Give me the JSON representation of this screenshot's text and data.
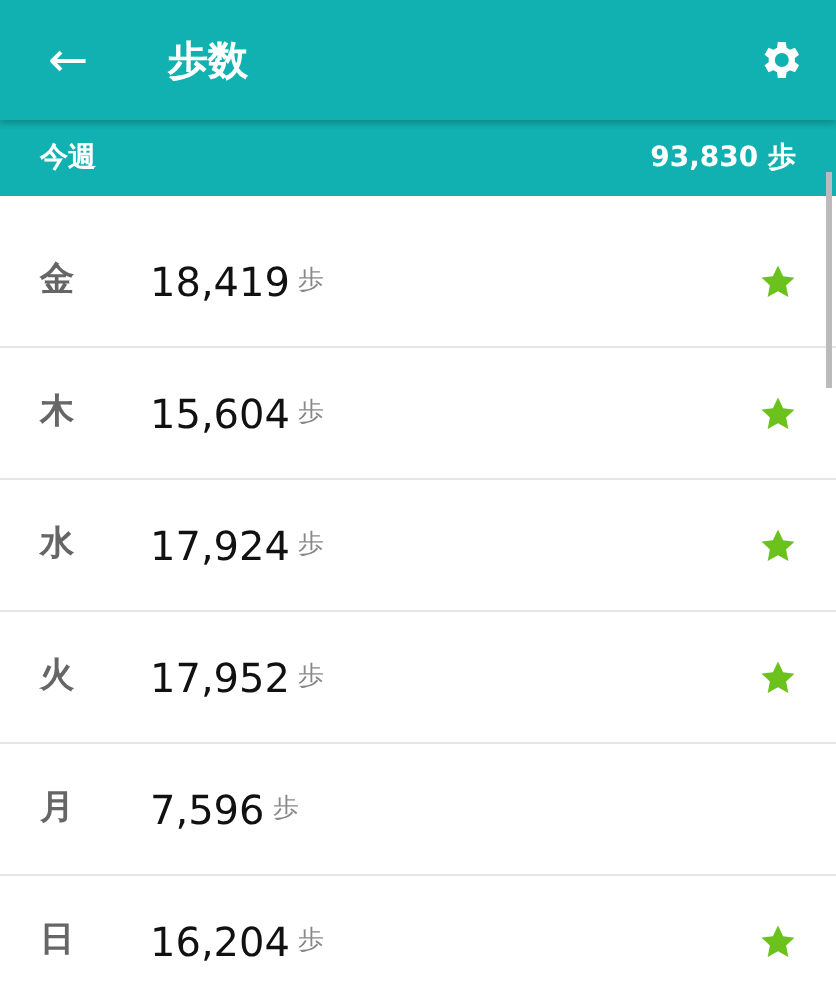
{
  "app_bar": {
    "back": "←",
    "title": "歩数"
  },
  "summary": {
    "label": "今週",
    "value": "93,830",
    "unit": "歩"
  },
  "days": [
    {
      "day": "金",
      "steps": "18,419",
      "unit": "歩",
      "goal_met": true
    },
    {
      "day": "木",
      "steps": "15,604",
      "unit": "歩",
      "goal_met": true
    },
    {
      "day": "水",
      "steps": "17,924",
      "unit": "歩",
      "goal_met": true
    },
    {
      "day": "火",
      "steps": "17,952",
      "unit": "歩",
      "goal_met": true
    },
    {
      "day": "月",
      "steps": "7,596",
      "unit": "歩",
      "goal_met": false
    },
    {
      "day": "日",
      "steps": "16,204",
      "unit": "歩",
      "goal_met": true
    }
  ]
}
